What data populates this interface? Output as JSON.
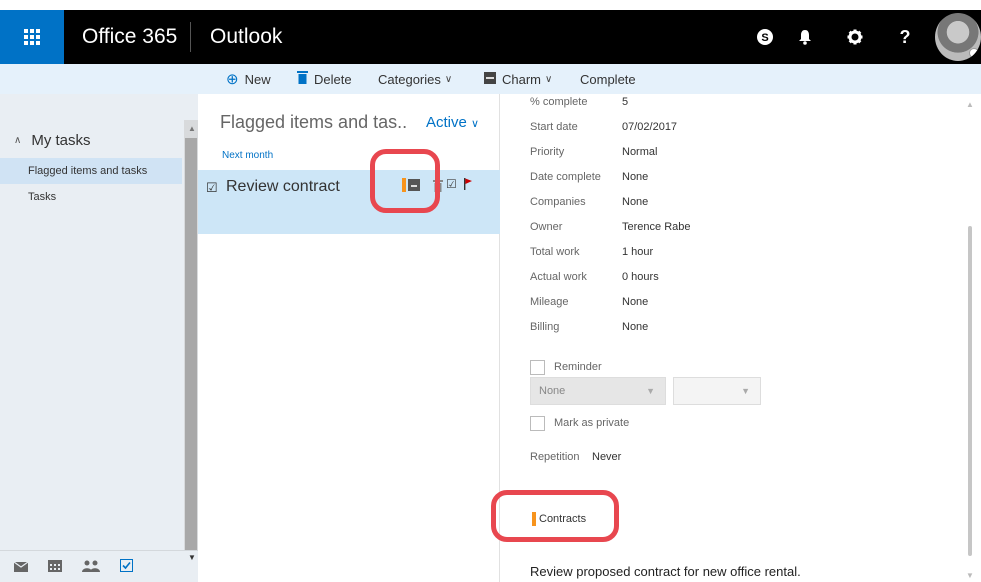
{
  "topbar": {
    "brand": "Office 365",
    "app": "Outlook",
    "icons": [
      "skype-icon",
      "bell-icon",
      "gear-icon",
      "help-icon"
    ],
    "help_label": "?"
  },
  "toolbar": {
    "new_label": "New",
    "delete_label": "Delete",
    "categories_label": "Categories",
    "charm_label": "Charm",
    "complete_label": "Complete"
  },
  "nav": {
    "title": "My tasks",
    "items": [
      {
        "label": "Flagged items and tasks",
        "selected": true
      },
      {
        "label": "Tasks",
        "selected": false
      }
    ]
  },
  "list": {
    "title": "Flagged items and tas..",
    "filter": "Active",
    "group": "Next month",
    "tasks": [
      {
        "subject": "Review contract",
        "category_color": "#f7941d"
      }
    ]
  },
  "details": {
    "fields": [
      {
        "label": "% complete",
        "value": "5"
      },
      {
        "label": "Start date",
        "value": "07/02/2017"
      },
      {
        "label": "Priority",
        "value": "Normal"
      },
      {
        "label": "Date complete",
        "value": "None"
      },
      {
        "label": "Companies",
        "value": "None"
      },
      {
        "label": "Owner",
        "value": "Terence Rabe"
      },
      {
        "label": "Total work",
        "value": "1 hour"
      },
      {
        "label": "Actual work",
        "value": "0 hours"
      },
      {
        "label": "Mileage",
        "value": "None"
      },
      {
        "label": "Billing",
        "value": "None"
      }
    ],
    "reminder_label": "Reminder",
    "reminder_value": "None",
    "private_label": "Mark as private",
    "repetition_label": "Repetition",
    "repetition_value": "Never",
    "category": "Contracts",
    "body": "Review proposed contract for new office rental."
  },
  "colors": {
    "brand_blue": "#0072c6",
    "category_orange": "#f7941d",
    "highlight_red": "#e8474f",
    "selected_row": "#cde6f7"
  }
}
